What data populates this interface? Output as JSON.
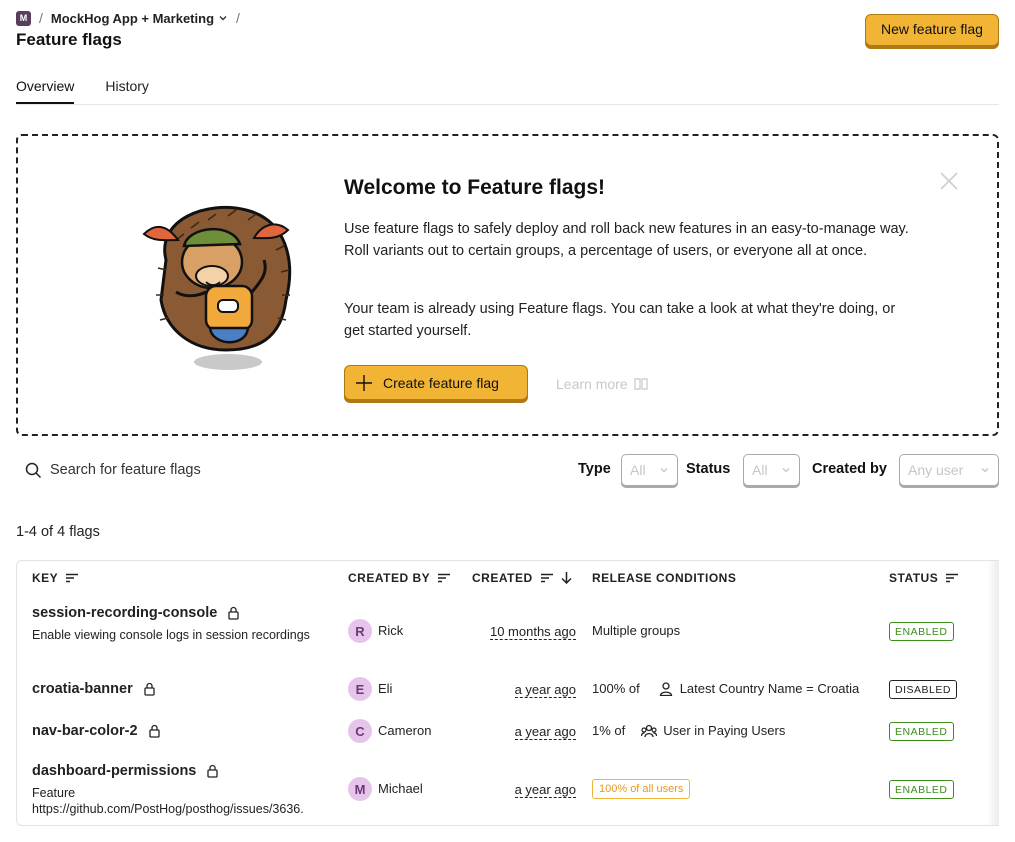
{
  "breadcrumb": {
    "project_initial": "M",
    "project_name": "MockHog App + Marketing",
    "separator": "/"
  },
  "page_title": "Feature flags",
  "header": {
    "new_flag_label": "New feature flag"
  },
  "tabs": [
    {
      "label": "Overview",
      "active": true
    },
    {
      "label": "History",
      "active": false
    }
  ],
  "welcome": {
    "title": "Welcome to Feature flags!",
    "paragraph1": "Use feature flags to safely deploy and roll back new features in an easy-to-manage way. Roll variants out to certain groups, a percentage of users, or everyone all at once.",
    "paragraph2": "Your team is already using Feature flags. You can take a look at what they're doing, or get started yourself.",
    "create_label": "Create feature flag",
    "learn_more_label": "Learn more"
  },
  "filters": {
    "search_placeholder": "Search for feature flags",
    "type_label": "Type",
    "type_value": "All",
    "status_label": "Status",
    "status_value": "All",
    "created_by_label": "Created by",
    "created_by_value": "Any user"
  },
  "count_text": "1-4 of 4 flags",
  "table": {
    "columns": {
      "key": "KEY",
      "created_by": "CREATED BY",
      "created": "CREATED",
      "release_conditions": "RELEASE CONDITIONS",
      "status": "STATUS"
    },
    "rows": [
      {
        "key": "session-recording-console",
        "description": "Enable viewing console logs in session recordings",
        "creator_initial": "R",
        "creator": "Rick",
        "created": "10 months ago",
        "condition_text": "Multiple groups",
        "status": "ENABLED"
      },
      {
        "key": "croatia-banner",
        "description": "",
        "creator_initial": "E",
        "creator": "Eli",
        "created": "a year ago",
        "condition_pct": "100% of",
        "condition_target": "Latest Country Name = Croatia",
        "condition_icon": "person-icon",
        "status": "DISABLED"
      },
      {
        "key": "nav-bar-color-2",
        "description": "",
        "creator_initial": "C",
        "creator": "Cameron",
        "created": "a year ago",
        "condition_pct": "1% of",
        "condition_target": "User in Paying Users",
        "condition_icon": "users-icon",
        "status": "ENABLED"
      },
      {
        "key": "dashboard-permissions",
        "description": "Feature https://github.com/PostHog/posthog/issues/3636.",
        "creator_initial": "M",
        "creator": "Michael",
        "created": "a year ago",
        "condition_badge": "100% of all users",
        "status": "ENABLED"
      }
    ]
  },
  "colors": {
    "primary_button": "#f1b434",
    "primary_button_border": "#b17816",
    "enabled_green": "#3b8f1a",
    "avatar_bg": "#e7c4ec"
  }
}
